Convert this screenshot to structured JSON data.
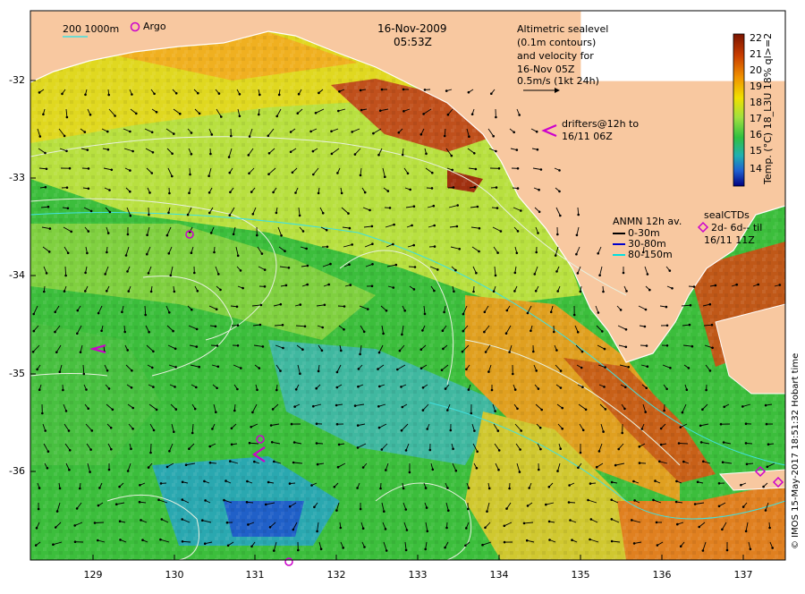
{
  "map": {
    "title_date": "16-Nov-2009",
    "title_time": "05:53Z",
    "lat_ticks": [
      "-32",
      "-33",
      "-34",
      "-35",
      "-36"
    ],
    "lon_ticks": [
      "129",
      "130",
      "131",
      "132",
      "133",
      "134",
      "135",
      "136",
      "137"
    ],
    "colorbar": {
      "ticks": [
        "22",
        "21",
        "20",
        "19",
        "18",
        "17",
        "16",
        "15",
        "14"
      ],
      "title": "Temp. (°C) 18_L3U 18% ql>=2"
    },
    "legend": {
      "contours": "200  1000m",
      "argo": "Argo",
      "altimetry": [
        "Altimetric sealevel",
        "(0.1m contours)",
        "and velocity for",
        "16-Nov 05Z",
        "0.5m/s (1kt 24h)"
      ],
      "drifters": [
        "drifters@12h to",
        "16/11 06Z"
      ],
      "anmn_title": "ANMN 12h av.",
      "anmn_items": [
        {
          "label": "0-30m",
          "color": "#000000"
        },
        {
          "label": "30-80m",
          "color": "#0000cc"
        },
        {
          "label": "80-150m",
          "color": "#00e0e0"
        }
      ],
      "sealctds_title": "sealCTDs",
      "sealctds_detail": "2d- 6d-- til",
      "sealctds_date": "16/11 11Z"
    },
    "credit": "© IMOS 15-May-2017 18:51:32 Hobart time",
    "colors": {
      "land": "#f8c8a0",
      "argo": "#cc00cc",
      "contour_deep": "#e0e0e0",
      "contour_shelf": "#40e0e0"
    }
  }
}
